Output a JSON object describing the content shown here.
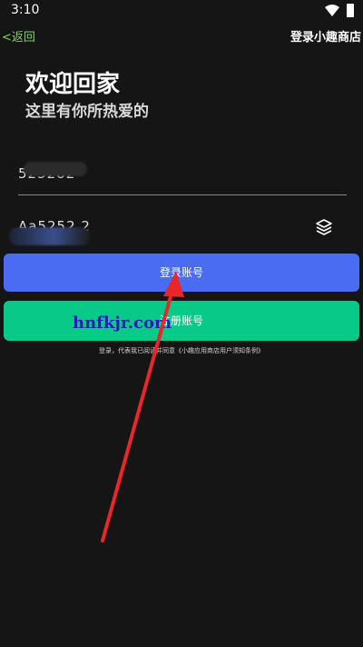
{
  "status_bar": {
    "time": "3:10"
  },
  "nav": {
    "back": "<返回",
    "title": "登录小趣商店"
  },
  "welcome": {
    "title": "欢迎回家",
    "subtitle": "这里有你所热爱的"
  },
  "form": {
    "account_value": "525282",
    "password_value": "Aa5252  2"
  },
  "buttons": {
    "login": "登录账号",
    "register": "注册账号"
  },
  "agreement": "登录，代表我已阅读并同意《小趣应用商店用户须知条例》",
  "watermark": "hnfkjr.com",
  "colors": {
    "primary": "#4a6cf2",
    "secondary": "#08c987",
    "back_link": "#7ed957",
    "arrow": "#e8262b"
  },
  "icons": {
    "wifi": "wifi-icon",
    "battery": "battery-icon",
    "password_toggle": "layers-icon"
  }
}
